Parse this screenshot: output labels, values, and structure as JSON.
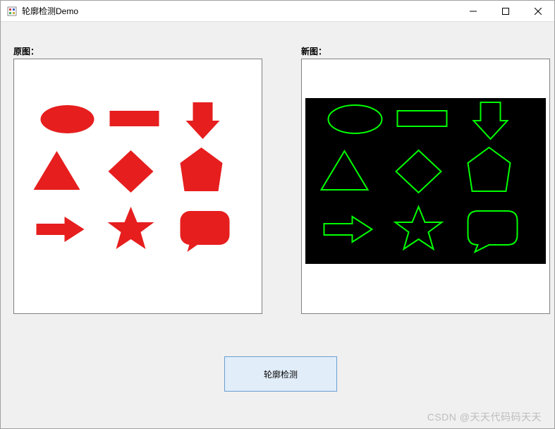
{
  "window": {
    "title": "轮廓检测Demo"
  },
  "labels": {
    "original": "原图：",
    "result": "新图："
  },
  "button": {
    "detect": "轮廓检测"
  },
  "watermark": "CSDN @天天代码码天天",
  "colors": {
    "shape_fill": "#e61e1e",
    "outline_stroke": "#00ff00",
    "result_bg": "#000000",
    "button_bg": "#e1edf9",
    "button_border": "#6a9fd0"
  },
  "shapes": [
    "ellipse",
    "rectangle",
    "arrow-down",
    "triangle",
    "diamond",
    "pentagon",
    "arrow-right",
    "star",
    "speech-bubble"
  ]
}
